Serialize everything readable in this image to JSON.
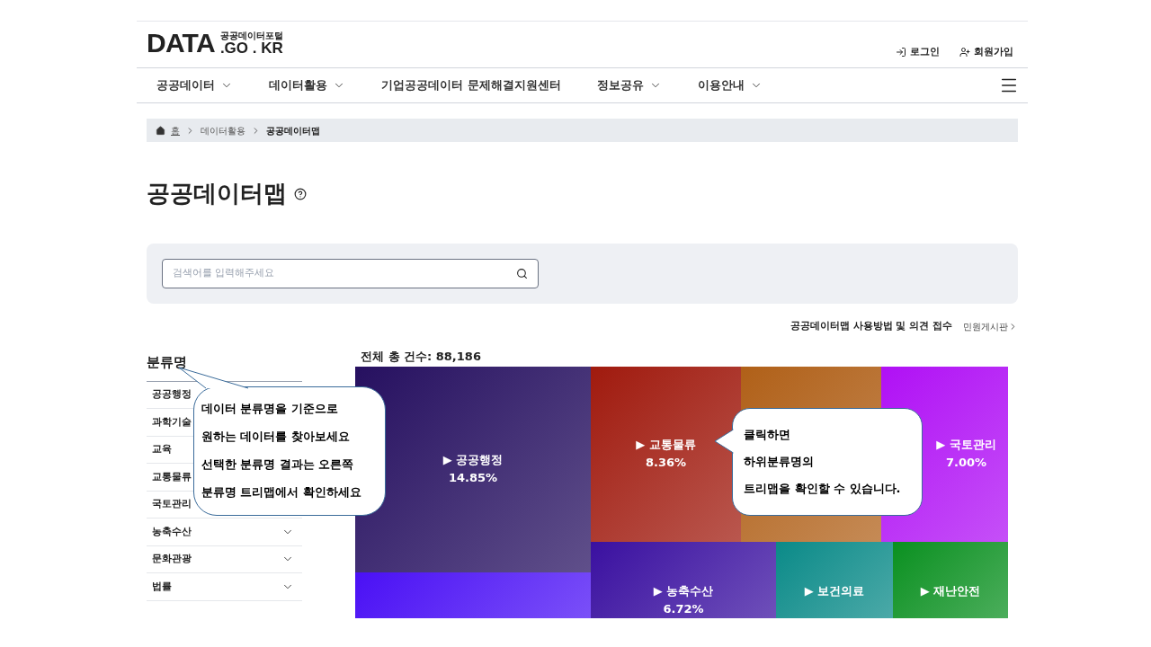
{
  "header": {
    "logo_main": "DATA",
    "logo_sub": "공공데이터포털",
    "logo_domain": ".GO . KR",
    "links": [
      {
        "label": "로그인",
        "kind": "login"
      },
      {
        "label": "회원가입",
        "kind": "signup"
      }
    ]
  },
  "nav": [
    {
      "label": "공공데이터",
      "dropdown": true
    },
    {
      "label": "데이터활용",
      "dropdown": true
    },
    {
      "label": "기업공공데이터 문제해결지원센터",
      "dropdown": false
    },
    {
      "label": "정보공유",
      "dropdown": true
    },
    {
      "label": "이용안내",
      "dropdown": true
    }
  ],
  "breadcrumb": [
    "홈",
    "데이터활용",
    "공공데이터맵"
  ],
  "page_title": "공공데이터맵",
  "search": {
    "placeholder": "검색어를 입력해주세요"
  },
  "usage_link": {
    "label": "공공데이터맵 사용방법 및 의견 접수",
    "board": "민원게시판"
  },
  "sidebar": {
    "title": "분류명",
    "items": [
      {
        "label": "공공행정",
        "expanded": false
      },
      {
        "label": "과학기술",
        "expanded": false
      },
      {
        "label": "교육",
        "expanded": false
      },
      {
        "label": "교통물류",
        "expanded": false
      },
      {
        "label": "국토관리",
        "expanded": false
      },
      {
        "label": "농축수산",
        "expanded": false
      },
      {
        "label": "문화관광",
        "expanded": false
      },
      {
        "label": "법률",
        "expanded": false
      }
    ]
  },
  "treemap": {
    "total": "전체 총 건수: 88,186",
    "tiles": [
      {
        "label": "▶ 공공행정",
        "percent": "14.85%",
        "color": "#261060"
      },
      {
        "color": "#4a10f5"
      },
      {
        "label": "▶ 교통물류",
        "percent": "8.36%",
        "color": "#a01a0e"
      },
      {
        "color": "#b06018"
      },
      {
        "label": "▶ 국토관리",
        "percent": "7.00%",
        "color": "#b010f5"
      },
      {
        "label": "▶ 농축수산",
        "percent": "6.72%",
        "color": "#3a10a0"
      },
      {
        "label": "▶ 보건의료",
        "color": "#0a8a88"
      },
      {
        "label": "▶ 재난안전",
        "color": "#0a9020"
      }
    ]
  },
  "callouts": [
    {
      "lines": [
        "데이터 분류명을 기준으로",
        "원하는 데이터를 찾아보세요",
        "선택한 분류명 결과는 오른쪽",
        "분류명 트리맵에서 확인하세요"
      ]
    },
    {
      "lines": [
        "클릭하면",
        "하위분류명의",
        "트리맵을 확인할 수 있습니다."
      ]
    }
  ]
}
